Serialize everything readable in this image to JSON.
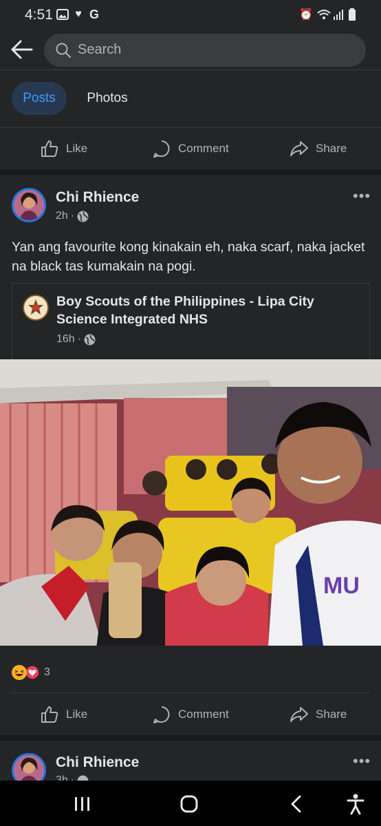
{
  "status_bar": {
    "time": "4:51"
  },
  "search": {
    "placeholder": "Search"
  },
  "tabs": [
    {
      "label": "Posts"
    },
    {
      "label": "Photos"
    }
  ],
  "actions": {
    "like": "Like",
    "comment": "Comment",
    "share": "Share"
  },
  "post": {
    "author": "Chi Rhience",
    "time": "2h",
    "text": "Yan ang favourite kong kinakain eh, naka scarf, naka jacket na black tas kumakain na pogi.",
    "shared": {
      "page_name": "Boy Scouts of the Philippines - Lipa City Science Integrated NHS",
      "time": "16h"
    },
    "reactions": {
      "icons": [
        "haha",
        "love"
      ],
      "count": "3"
    }
  },
  "next_post": {
    "author": "Chi Rhience",
    "time": "3h"
  },
  "colors": {
    "accent": "#2374e1",
    "background": "#18191a",
    "surface": "#242526"
  }
}
